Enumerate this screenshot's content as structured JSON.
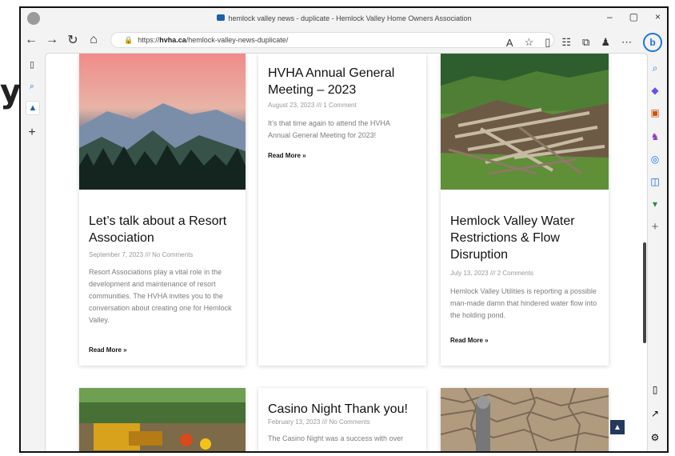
{
  "browser": {
    "title": "hemlock valley news - duplicate - Hemlock Valley Home Owners Association",
    "url_prefix": "https://",
    "url_host": "hvha.ca",
    "url_path": "/hemlock-valley-news-duplicate/"
  },
  "cards": [
    {
      "title": "Let’s talk about a Resort Association",
      "meta": "September 7, 2023 /// No Comments",
      "excerpt": "Resort Associations play a vital role in the development and maintenance of resort communities. The HVHA invites you to the conversation about creating one for Hemlock Valley.",
      "read_more": "Read More »"
    },
    {
      "title": "HVHA Annual General Meeting – 2023",
      "meta": "August 23, 2023 /// 1 Comment",
      "excerpt": "It’s that time again to attend the HVHA Annual General Meeting for 2023!",
      "read_more": "Read More »"
    },
    {
      "title": "Hemlock Valley Water Restrictions & Flow Disruption",
      "meta": "July 13, 2023 /// 2 Comments",
      "excerpt": "Hemlock Valley Utilities is reporting a possible man-made damn that hindered water flow into the holding pond.",
      "read_more": "Read More »"
    },
    {
      "title": "Casino Night Thank you!",
      "meta": "February 13, 2023 /// No Comments",
      "excerpt": "The Casino Night was a success with over"
    }
  ],
  "left_partial": "y",
  "colors": {
    "sunset_top": "#f08b8b",
    "mountain": "#6a7a92",
    "forest": "#1f3b2f",
    "grass": "#5f8f37",
    "dry_earth": "#b09b7f",
    "dark": "#23395d"
  },
  "icons": [
    "back-arrow-icon",
    "forward-arrow-icon",
    "refresh-icon",
    "home-icon",
    "lock-icon",
    "read-aloud-icon",
    "favorite-star-icon",
    "split-screen-icon",
    "favorites-icon",
    "collections-icon",
    "extensions-icon",
    "more-icon",
    "bing-icon",
    "sidebar-icons"
  ]
}
